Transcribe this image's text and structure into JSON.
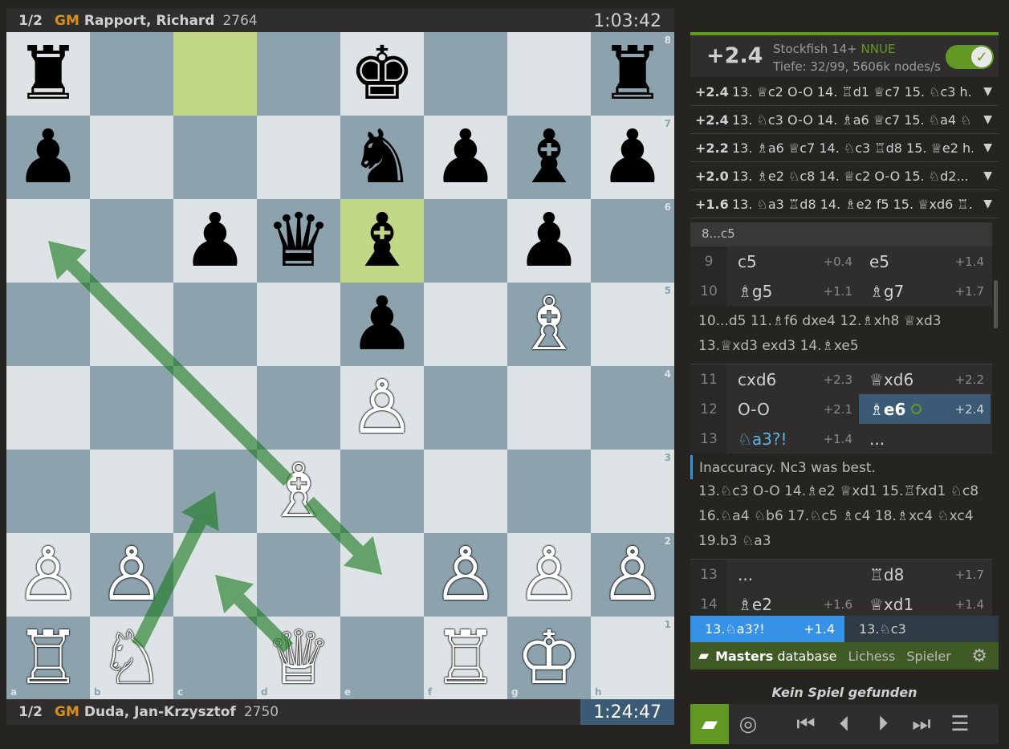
{
  "top_player": {
    "score": "1/2",
    "title": "GM",
    "name": "Rapport, Richard",
    "rating": "2764",
    "clock": "1:03:42"
  },
  "bottom_player": {
    "score": "1/2",
    "title": "GM",
    "name": "Duda, Jan-Krzysztof",
    "rating": "2750",
    "clock": "1:24:47"
  },
  "board": {
    "files": [
      "a",
      "b",
      "c",
      "d",
      "e",
      "f",
      "g",
      "h"
    ],
    "ranks": [
      "8",
      "7",
      "6",
      "5",
      "4",
      "3",
      "2",
      "1"
    ],
    "highlighted_squares": [
      "c8",
      "e6"
    ],
    "pieces": [
      {
        "square": "a8",
        "glyph": "♜",
        "color": "b",
        "name": "black-rook-icon"
      },
      {
        "square": "e8",
        "glyph": "♚",
        "color": "b",
        "name": "black-king-icon"
      },
      {
        "square": "h8",
        "glyph": "♜",
        "color": "b",
        "name": "black-rook-icon"
      },
      {
        "square": "a7",
        "glyph": "♟",
        "color": "b",
        "name": "black-pawn-icon"
      },
      {
        "square": "e7",
        "glyph": "♞",
        "color": "b",
        "name": "black-knight-icon"
      },
      {
        "square": "f7",
        "glyph": "♟",
        "color": "b",
        "name": "black-pawn-icon"
      },
      {
        "square": "g7",
        "glyph": "♝",
        "color": "b",
        "name": "black-bishop-icon"
      },
      {
        "square": "h7",
        "glyph": "♟",
        "color": "b",
        "name": "black-pawn-icon"
      },
      {
        "square": "c6",
        "glyph": "♟",
        "color": "b",
        "name": "black-pawn-icon"
      },
      {
        "square": "d6",
        "glyph": "♛",
        "color": "b",
        "name": "black-queen-icon"
      },
      {
        "square": "e6",
        "glyph": "♝",
        "color": "b",
        "name": "black-bishop-icon"
      },
      {
        "square": "g6",
        "glyph": "♟",
        "color": "b",
        "name": "black-pawn-icon"
      },
      {
        "square": "e5",
        "glyph": "♟",
        "color": "b",
        "name": "black-pawn-icon"
      },
      {
        "square": "g5",
        "glyph": "♗",
        "color": "w",
        "name": "white-bishop-icon"
      },
      {
        "square": "e4",
        "glyph": "♙",
        "color": "w",
        "name": "white-pawn-icon"
      },
      {
        "square": "d3",
        "glyph": "♗",
        "color": "w",
        "name": "white-bishop-icon"
      },
      {
        "square": "a2",
        "glyph": "♙",
        "color": "w",
        "name": "white-pawn-icon"
      },
      {
        "square": "b2",
        "glyph": "♙",
        "color": "w",
        "name": "white-pawn-icon"
      },
      {
        "square": "f2",
        "glyph": "♙",
        "color": "w",
        "name": "white-pawn-icon"
      },
      {
        "square": "g2",
        "glyph": "♙",
        "color": "w",
        "name": "white-pawn-icon"
      },
      {
        "square": "h2",
        "glyph": "♙",
        "color": "w",
        "name": "white-pawn-icon"
      },
      {
        "square": "a1",
        "glyph": "♖",
        "color": "w",
        "name": "white-rook-icon"
      },
      {
        "square": "b1",
        "glyph": "♘",
        "color": "w",
        "name": "white-knight-icon"
      },
      {
        "square": "d1",
        "glyph": "♕",
        "color": "w",
        "name": "white-queen-icon"
      },
      {
        "square": "f1",
        "glyph": "♖",
        "color": "w",
        "name": "white-rook-icon"
      },
      {
        "square": "g1",
        "glyph": "♔",
        "color": "w",
        "name": "white-king-icon"
      }
    ],
    "arrows": [
      {
        "from": "b1",
        "to": "c3",
        "color": "#15781b"
      },
      {
        "from": "d1",
        "to": "c2",
        "color": "#15781b"
      },
      {
        "from": "d3",
        "to": "e2",
        "color": "#15781b"
      },
      {
        "from": "d3",
        "to": "a6",
        "color": "#15781b"
      }
    ]
  },
  "engine": {
    "eval": "+2.4",
    "name": "Stockfish 14+",
    "nnue": "NNUE",
    "depth": "Tiefe: 32/99, 5606k nodes/s",
    "check_icon": "check-icon"
  },
  "pv_lines": [
    {
      "eval": "+2.4",
      "moves": "13. ♕c2 O-O 14. ♖d1 ♕c7 15. ♘c3 h...",
      "arrow": "▼"
    },
    {
      "eval": "+2.4",
      "moves": "13. ♘c3 O-O 14. ♗a6 ♕c7 15. ♘a4 ♘...",
      "arrow": "▼"
    },
    {
      "eval": "+2.2",
      "moves": "13. ♗a6 ♕c7 14. ♘c3 ♖d8 15. ♕e2 h...",
      "arrow": "▼"
    },
    {
      "eval": "+2.0",
      "moves": "13. ♗e2 ♘c8 14. ♕c2 O-O 15. ♘d2...",
      "arrow": "▼"
    },
    {
      "eval": "+1.6",
      "moves": "13. ♘a3 ♖d8 14. ♗e2 f5 15. ♕xd6 ♖...",
      "arrow": "▼"
    }
  ],
  "moves": {
    "intro": "8...c5",
    "rows_a": [
      {
        "num": "9",
        "white": "c5",
        "white_eval": "+0.4",
        "black": "e5",
        "black_eval": "+1.4"
      },
      {
        "num": "10",
        "white": "♗g5",
        "white_eval": "+1.1",
        "black": "♗g7",
        "black_eval": "+1.7"
      }
    ],
    "variation_1": "10...d5 11.♗f6 dxe4 12.♗xh8 ♕xd3",
    "variation_1b": "13.♕xd3 exd3 14.♗xe5",
    "rows_b": [
      {
        "num": "11",
        "white": "cxd6",
        "white_eval": "+2.3",
        "black": "♕xd6",
        "black_eval": "+2.2"
      },
      {
        "num": "12",
        "white": "O-O",
        "white_eval": "+2.1",
        "black": "♗e6",
        "black_eval": "+2.4"
      },
      {
        "num": "13",
        "white": "♘a3?!",
        "white_eval": "+1.4",
        "black": "...",
        "black_eval": ""
      }
    ],
    "comment": "Inaccuracy. Nc3 was best.",
    "variation_2a": "13.♘c3 O-O 14.♗e2 ♕xd1 15.♖fxd1 ♘c8",
    "variation_2b": "16.♘a4 ♘b6 17.♘c5 ♗c4 18.♗xc4 ♘xc4",
    "variation_2c": "19.b3 ♘a3",
    "rows_c": [
      {
        "num": "13",
        "white": "...",
        "white_eval": "",
        "black": "♖d8",
        "black_eval": "+1.7"
      },
      {
        "num": "14",
        "white": "♗e2",
        "white_eval": "+1.6",
        "black": "♕xd1",
        "black_eval": "+1.4"
      }
    ]
  },
  "preview": {
    "left_move": "13.♘a3?!",
    "left_eval": "+1.4",
    "right_move": "13.♘c3"
  },
  "explorer": {
    "book_icon": "book-icon",
    "tab_masters_bold": "Masters",
    "tab_masters_rest": " database",
    "tab_lichess": "Lichess",
    "tab_player": "Spieler",
    "gear_icon": "gear-icon",
    "empty_message": "Kein Spiel gefunden"
  },
  "controls": [
    {
      "name": "book-icon",
      "glyph": "▰"
    },
    {
      "name": "target-icon",
      "glyph": "◎"
    },
    {
      "name": "first-move-icon",
      "glyph": "⏮"
    },
    {
      "name": "prev-move-icon",
      "glyph": "⏴"
    },
    {
      "name": "next-move-icon",
      "glyph": "⏵"
    },
    {
      "name": "last-move-icon",
      "glyph": "⏭"
    },
    {
      "name": "menu-icon",
      "glyph": "☰"
    }
  ],
  "colors": {
    "accent": "#629924",
    "active_move": "#3b5a76",
    "inaccuracy": "#56b4e9",
    "arrow": "#15781b",
    "highlight": "#c3d887"
  }
}
